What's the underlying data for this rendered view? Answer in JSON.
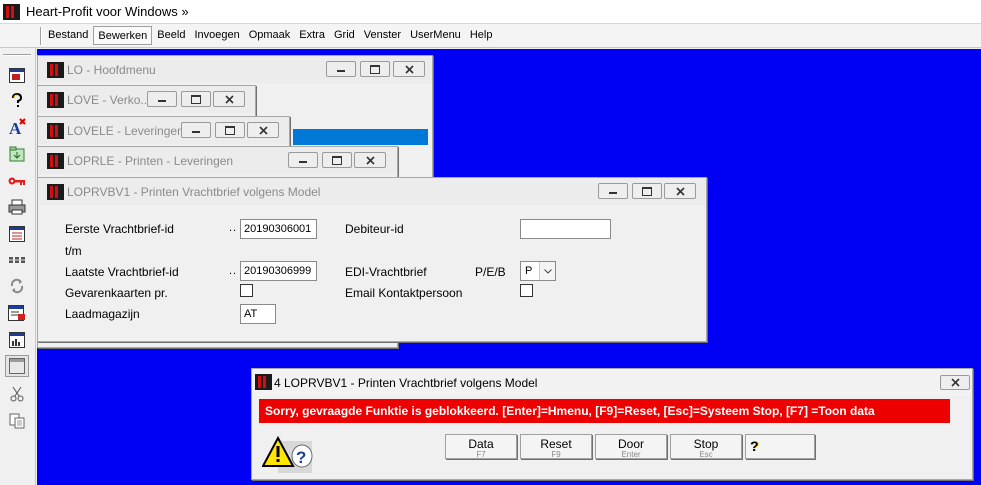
{
  "app": {
    "title": "Heart-Profit voor Windows  »"
  },
  "menu": [
    "Bestand",
    "Bewerken",
    "Beeld",
    "Invoegen",
    "Opmaak",
    "Extra",
    "Grid",
    "Venster",
    "UserMenu",
    "Help"
  ],
  "toolbar_icons": [
    "window-icon",
    "help-icon",
    "font-icon",
    "import-icon",
    "key-icon",
    "print-icon",
    "form-icon",
    "columns-icon",
    "refresh-icon",
    "report-icon",
    "chart-icon",
    "panel-icon",
    "cut-icon",
    "copy-icon"
  ],
  "windows": {
    "lo": {
      "title": "LO - Hoofdmenu"
    },
    "love": {
      "title": "LOVE - Verko..."
    },
    "lovele": {
      "title": "LOVELE - Leveringen"
    },
    "loprle": {
      "title": "LOPRLE - Printen - Leveringen"
    },
    "loprvbv1": {
      "title": "LOPRVBV1 - Printen Vrachtbrief volgens Model"
    }
  },
  "form": {
    "first_label": "Eerste  Vrachtbrief-id",
    "first_dots": "..",
    "first_value": "20190306001",
    "tm_label": "t/m",
    "last_label": "Laatste Vrachtbrief-id",
    "last_dots": "..",
    "last_value": "20190306999",
    "hazard_label": "Gevarenkaarten pr.",
    "warehouse_label": "Laadmagazijn",
    "warehouse_value": "AT",
    "debtor_label": "Debiteur-id",
    "debtor_value": "",
    "edi_label": "EDI-Vrachtbrief",
    "edi_hint": "P/E/B",
    "edi_value": "P",
    "email_label": "Email Kontaktpersoon"
  },
  "message": {
    "title": "4 LOPRVBV1 - Printen Vrachtbrief volgens Model",
    "text": "Sorry, gevraagde Funktie is geblokkeerd.  [Enter]=Hmenu, [F9]=Reset, [Esc]=Systeem Stop, [F7] =Toon data",
    "buttons": [
      {
        "label": "Data",
        "key": "F7"
      },
      {
        "label": "Reset",
        "key": "F9"
      },
      {
        "label": "Door",
        "key": "Enter"
      },
      {
        "label": "Stop",
        "key": "Esc"
      }
    ],
    "help_glyph": "?"
  },
  "colors": {
    "mdi_background": "#0000f5",
    "error_bar": "#ee0000",
    "selection": "#0078d7"
  }
}
